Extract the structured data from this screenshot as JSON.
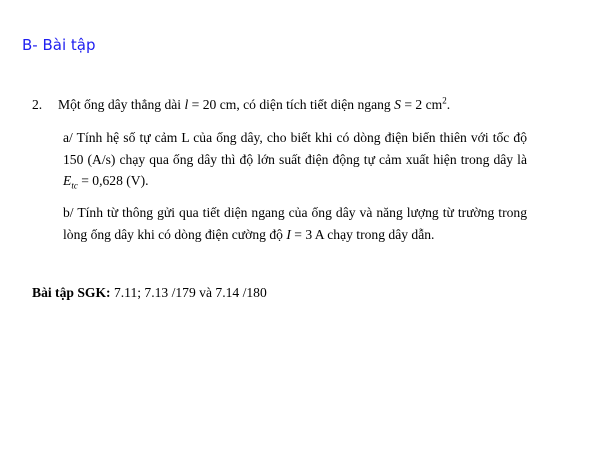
{
  "heading": "B- Bài tập",
  "problem": {
    "number": "2.",
    "intro_prefix": "Một ống dây thẳng dài ",
    "length_symbol": "l",
    "length_value": " = 20 cm, có diện tích tiết diện ngang ",
    "area_symbol": "S",
    "area_value": " = 2 cm",
    "area_exponent": "2",
    "intro_suffix": "."
  },
  "part_a": {
    "text": "a/ Tính hệ số tự cảm L của ống dây, cho biết khi có dòng điện biến thiên với tốc độ 150 (A/s) chạy qua ống dây thì độ lớn suất điện động tự cảm xuất hiện trong dây là ",
    "emf_symbol": "E",
    "emf_subscript": "tc",
    "emf_value": " = 0,628  (V)."
  },
  "part_b": {
    "text": "b/ Tính từ thông gửi qua tiết diện ngang của ống dây và năng lượng từ trường trong lòng ống dây khi có dòng điện cường độ ",
    "current_symbol": "I",
    "current_value": " = 3 A chạy trong dây dẫn."
  },
  "sgk": {
    "label": "Bài tập SGK:",
    "text": "  7.11;  7.13 /179 và 7.14 /180"
  }
}
